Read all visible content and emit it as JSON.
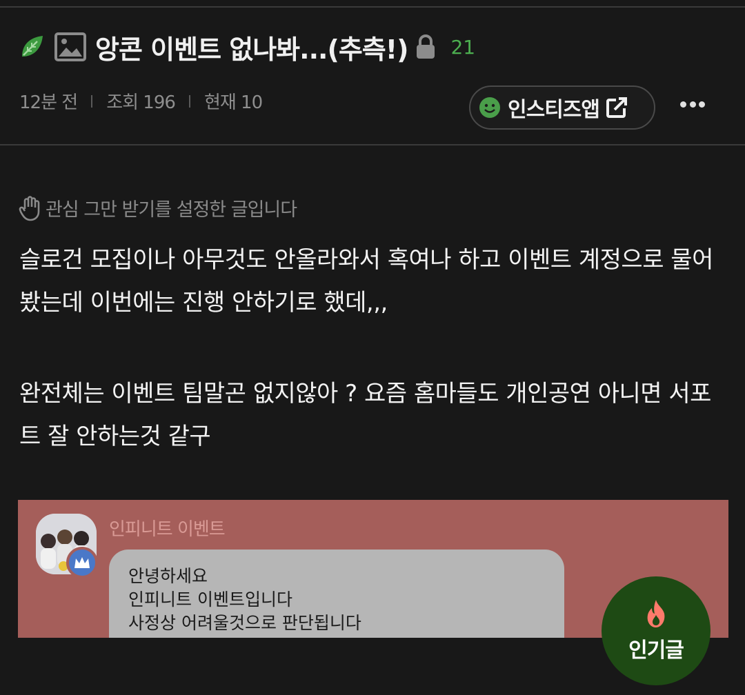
{
  "post": {
    "title": "앙콘 이벤트 없나봐...(추측!)",
    "comment_count": "21",
    "meta": {
      "time": "12분 전",
      "views": "조회 196",
      "current": "현재 10"
    },
    "app_button_label": "인스티즈앱",
    "notice": "관심 그만 받기를 설정한 글입니다",
    "body": [
      "슬로건 모집이나 아무것도 안올라와서 혹여나 하고 이벤트 계정으로 물어봤는데 이번에는 진행 안하기로 했데,,,",
      "완전체는 이벤트 팀말곤 없지않아 ? 요즘 홈마들도 개인공연 아니면 서포트 잘 안하는것 같구"
    ]
  },
  "capture": {
    "sender": "인피니트 이벤트",
    "messages": [
      "안녕하세요",
      "인피니트 이벤트입니다",
      "사정상 어려울것으로 판단됩니다"
    ]
  },
  "fab": {
    "label": "인기글"
  },
  "colors": {
    "background": "#181818",
    "accent_green": "#4caf50",
    "capture_bg": "#a55e5a",
    "fab_bg": "#1e4a14",
    "fire": "#ff7a6b"
  }
}
